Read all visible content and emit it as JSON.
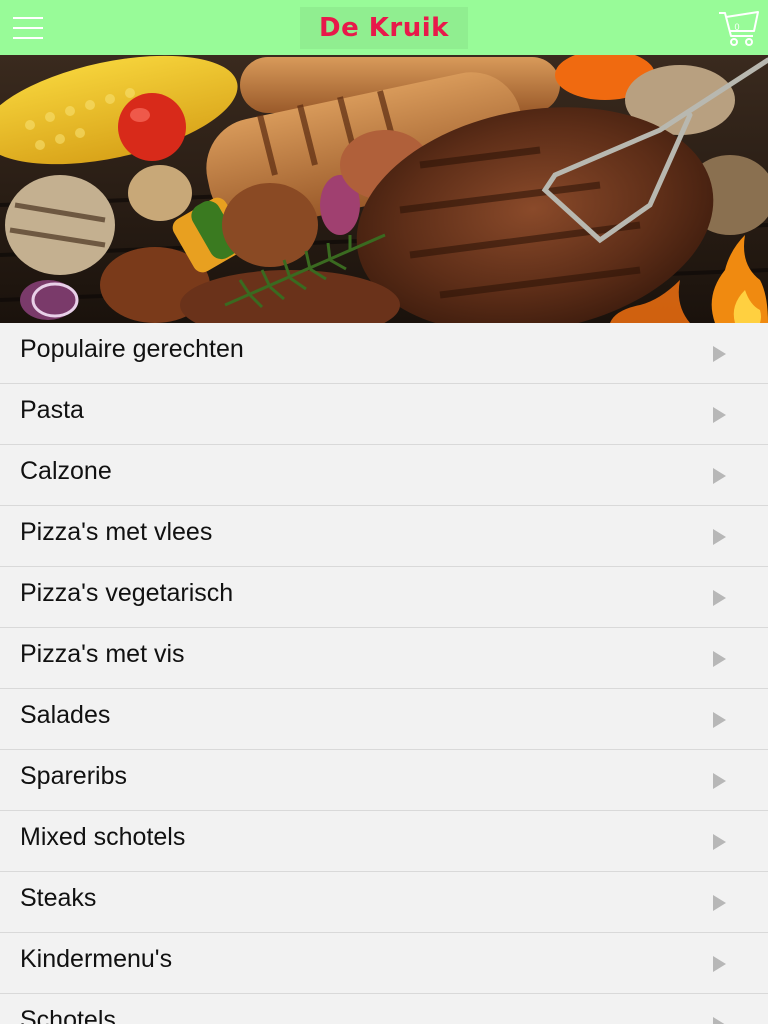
{
  "header": {
    "logo_text": "De Kruik",
    "cart_count": "0",
    "colors": {
      "background": "#98fb98",
      "logo_bg": "#90ee90",
      "logo_text": "#e8194a"
    }
  },
  "hero": {
    "image_name": "grilled-meat-banner"
  },
  "categories": [
    {
      "label": "Populaire gerechten"
    },
    {
      "label": "Pasta"
    },
    {
      "label": "Calzone"
    },
    {
      "label": "Pizza's met vlees"
    },
    {
      "label": "Pizza's vegetarisch"
    },
    {
      "label": "Pizza's met vis"
    },
    {
      "label": "Salades"
    },
    {
      "label": "Spareribs"
    },
    {
      "label": "Mixed schotels"
    },
    {
      "label": "Steaks"
    },
    {
      "label": "Kindermenu's"
    },
    {
      "label": "Schotels"
    }
  ],
  "icons": {
    "menu": "hamburger-menu-icon",
    "cart": "shopping-cart-icon",
    "row_arrow": "chevron-right-icon"
  }
}
